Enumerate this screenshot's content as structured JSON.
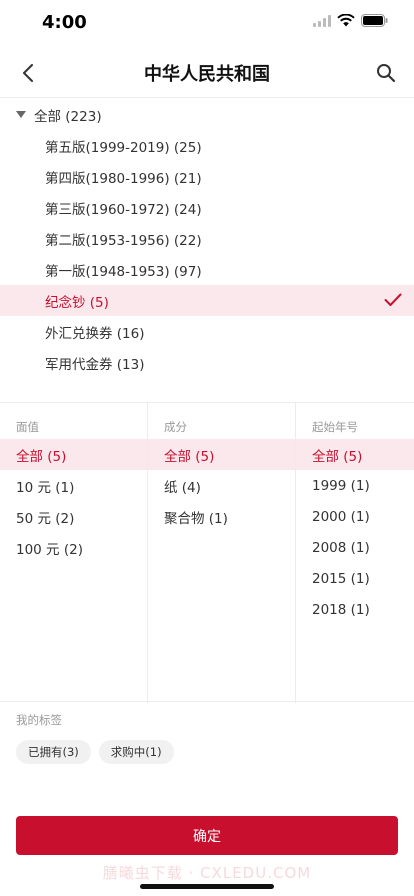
{
  "status_bar": {
    "time": "4:00"
  },
  "nav": {
    "title": "中华人民共和国"
  },
  "tree": {
    "root": {
      "label": "全部 (223)"
    },
    "items": [
      {
        "label": "第五版(1999-2019) (25)",
        "selected": false
      },
      {
        "label": "第四版(1980-1996) (21)",
        "selected": false
      },
      {
        "label": "第三版(1960-1972) (24)",
        "selected": false
      },
      {
        "label": "第二版(1953-1956) (22)",
        "selected": false
      },
      {
        "label": "第一版(1948-1953) (97)",
        "selected": false
      },
      {
        "label": "纪念钞 (5)",
        "selected": true
      },
      {
        "label": "外汇兑换券 (16)",
        "selected": false
      },
      {
        "label": "军用代金券 (13)",
        "selected": false
      }
    ]
  },
  "filters": {
    "denomination": {
      "header": "面值",
      "options": [
        "全部 (5)",
        "10 元 (1)",
        "50 元 (2)",
        "100 元 (2)"
      ]
    },
    "material": {
      "header": "成分",
      "options": [
        "全部 (5)",
        "纸 (4)",
        "聚合物 (1)"
      ]
    },
    "start_year": {
      "header": "起始年号",
      "options": [
        "全部 (5)",
        "1999 (1)",
        "2000 (1)",
        "2008 (1)",
        "2015 (1)",
        "2018 (1)"
      ]
    }
  },
  "tags": {
    "title": "我的标签",
    "items": [
      "已拥有(3)",
      "求购中(1)"
    ]
  },
  "confirm_label": "确定",
  "watermark": "膳曦虫下载 · CXLEDU.COM",
  "colors": {
    "accent": "#c8102e",
    "selected_bg": "#fbe8ec"
  }
}
